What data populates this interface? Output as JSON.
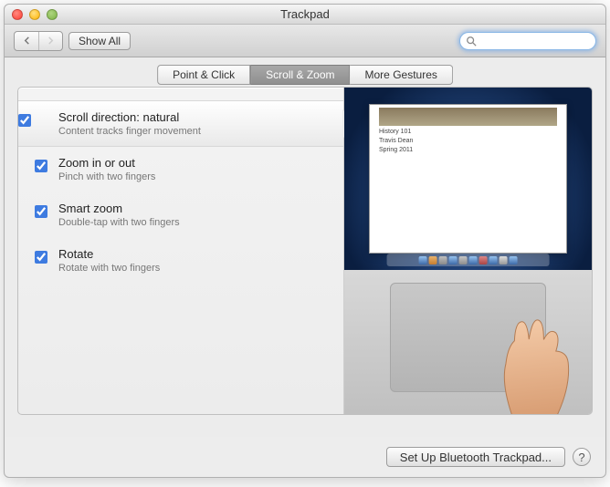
{
  "window": {
    "title": "Trackpad"
  },
  "toolbar": {
    "show_all": "Show All",
    "search_placeholder": ""
  },
  "tabs": [
    "Point & Click",
    "Scroll & Zoom",
    "More Gestures"
  ],
  "active_tab_index": 1,
  "settings": [
    {
      "title": "Scroll direction: natural",
      "subtitle": "Content tracks finger movement",
      "checked": true,
      "selected": true
    },
    {
      "title": "Zoom in or out",
      "subtitle": "Pinch with two fingers",
      "checked": true,
      "selected": false
    },
    {
      "title": "Smart zoom",
      "subtitle": "Double-tap with two fingers",
      "checked": true,
      "selected": false
    },
    {
      "title": "Rotate",
      "subtitle": "Rotate with two fingers",
      "checked": true,
      "selected": false
    }
  ],
  "preview_doc_lines": [
    "History 101",
    "Travis Dean",
    "Spring 2011"
  ],
  "footer": {
    "bluetooth": "Set Up Bluetooth Trackpad...",
    "help": "?"
  }
}
